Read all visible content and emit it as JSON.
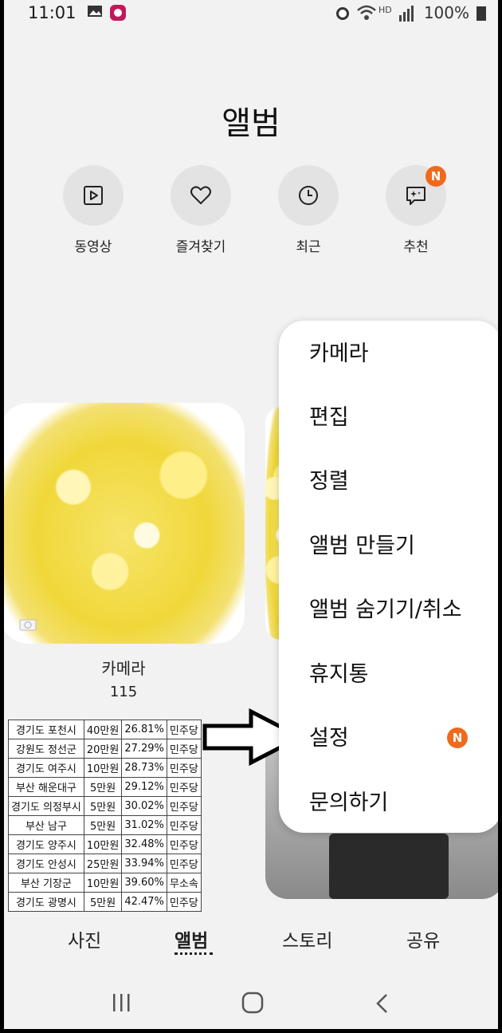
{
  "status_bar": {
    "time": "11:01",
    "battery": "100%"
  },
  "header": {
    "title": "앨범"
  },
  "quick_actions": [
    {
      "label": "동영상",
      "icon": "video-icon"
    },
    {
      "label": "즐겨찾기",
      "icon": "heart-icon"
    },
    {
      "label": "최근",
      "icon": "clock-icon"
    },
    {
      "label": "추천",
      "icon": "sparkle-chat-icon",
      "badge": "N"
    }
  ],
  "album": {
    "name": "카메라",
    "count": "115"
  },
  "fee_table": [
    [
      "경기도 포천시",
      "40만원",
      "26.81%",
      "민주당"
    ],
    [
      "강원도 정선군",
      "20만원",
      "27.29%",
      "민주당"
    ],
    [
      "경기도 여주시",
      "10만원",
      "28.73%",
      "민주당"
    ],
    [
      "부산 해운대구",
      "5만원",
      "29.12%",
      "민주당"
    ],
    [
      "경기도 의정부시",
      "5만원",
      "30.02%",
      "민주당"
    ],
    [
      "부산 남구",
      "5만원",
      "31.02%",
      "민주당"
    ],
    [
      "경기도 양주시",
      "10만원",
      "32.48%",
      "민주당"
    ],
    [
      "경기도 안성시",
      "25만원",
      "33.94%",
      "민주당"
    ],
    [
      "부산 기장군",
      "10만원",
      "39.60%",
      "무소속"
    ],
    [
      "경기도 광명시",
      "5만원",
      "42.47%",
      "민주당"
    ]
  ],
  "menu": {
    "items": [
      "카메라",
      "편집",
      "정렬",
      "앨범 만들기",
      "앨범 숨기기/취소",
      "휴지통",
      "설정",
      "문의하기"
    ],
    "settings_badge": "N"
  },
  "tabs": [
    "사진",
    "앨범",
    "스토리",
    "공유"
  ],
  "colors": {
    "badge": "#f06a1c",
    "background": "#f2f2f2",
    "menu_bg": "#ffffff"
  }
}
